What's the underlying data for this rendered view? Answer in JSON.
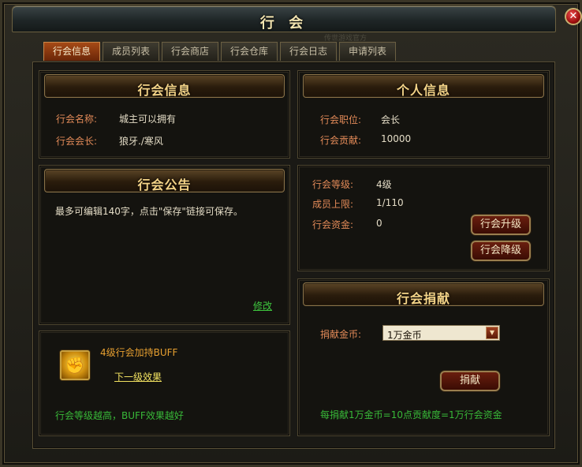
{
  "window": {
    "title": "行 会",
    "close_glyph": "✕",
    "watermark": "传世游戏官方"
  },
  "tabs": [
    {
      "label": "行会信息",
      "active": true
    },
    {
      "label": "成员列表",
      "active": false
    },
    {
      "label": "行会商店",
      "active": false
    },
    {
      "label": "行会仓库",
      "active": false
    },
    {
      "label": "行会日志",
      "active": false
    },
    {
      "label": "申请列表",
      "active": false
    }
  ],
  "guild_info": {
    "header": "行会信息",
    "name_label": "行会名称:",
    "name_value": "城主可以拥有",
    "leader_label": "行会会长:",
    "leader_value": "狼牙./寒风"
  },
  "personal_info": {
    "header": "个人信息",
    "position_label": "行会职位:",
    "position_value": "会长",
    "contribution_label": "行会贡献:",
    "contribution_value": "10000"
  },
  "announcement": {
    "header": "行会公告",
    "text": "最多可编辑140字，点击\"保存\"链接可保存。",
    "edit_link": "修改"
  },
  "guild_stats": {
    "level_label": "行会等级:",
    "level_value": "4级",
    "members_label": "成员上限:",
    "members_value": "1/110",
    "funds_label": "行会资金:",
    "funds_value": "0",
    "upgrade_button": "行会升级",
    "downgrade_button": "行会降级"
  },
  "buff": {
    "icon": "fist-icon",
    "title": "4级行会加持BUFF",
    "next_link": "下一级效果",
    "tip": "行会等级越高，BUFF效果越好"
  },
  "donation": {
    "header": "行会捐献",
    "gold_label": "捐献金币:",
    "gold_selected": "1万金币",
    "donate_button": "捐献",
    "rate_text": "每捐献1万金币=10点贡献度=1万行会资金"
  },
  "colors": {
    "accent_orange": "#e28a58",
    "header_gold": "#f4d488",
    "link_green": "#3ec83e",
    "tip_green": "#38b838",
    "buff_orange": "#e8a030",
    "link_yellow": "#f0e060"
  }
}
